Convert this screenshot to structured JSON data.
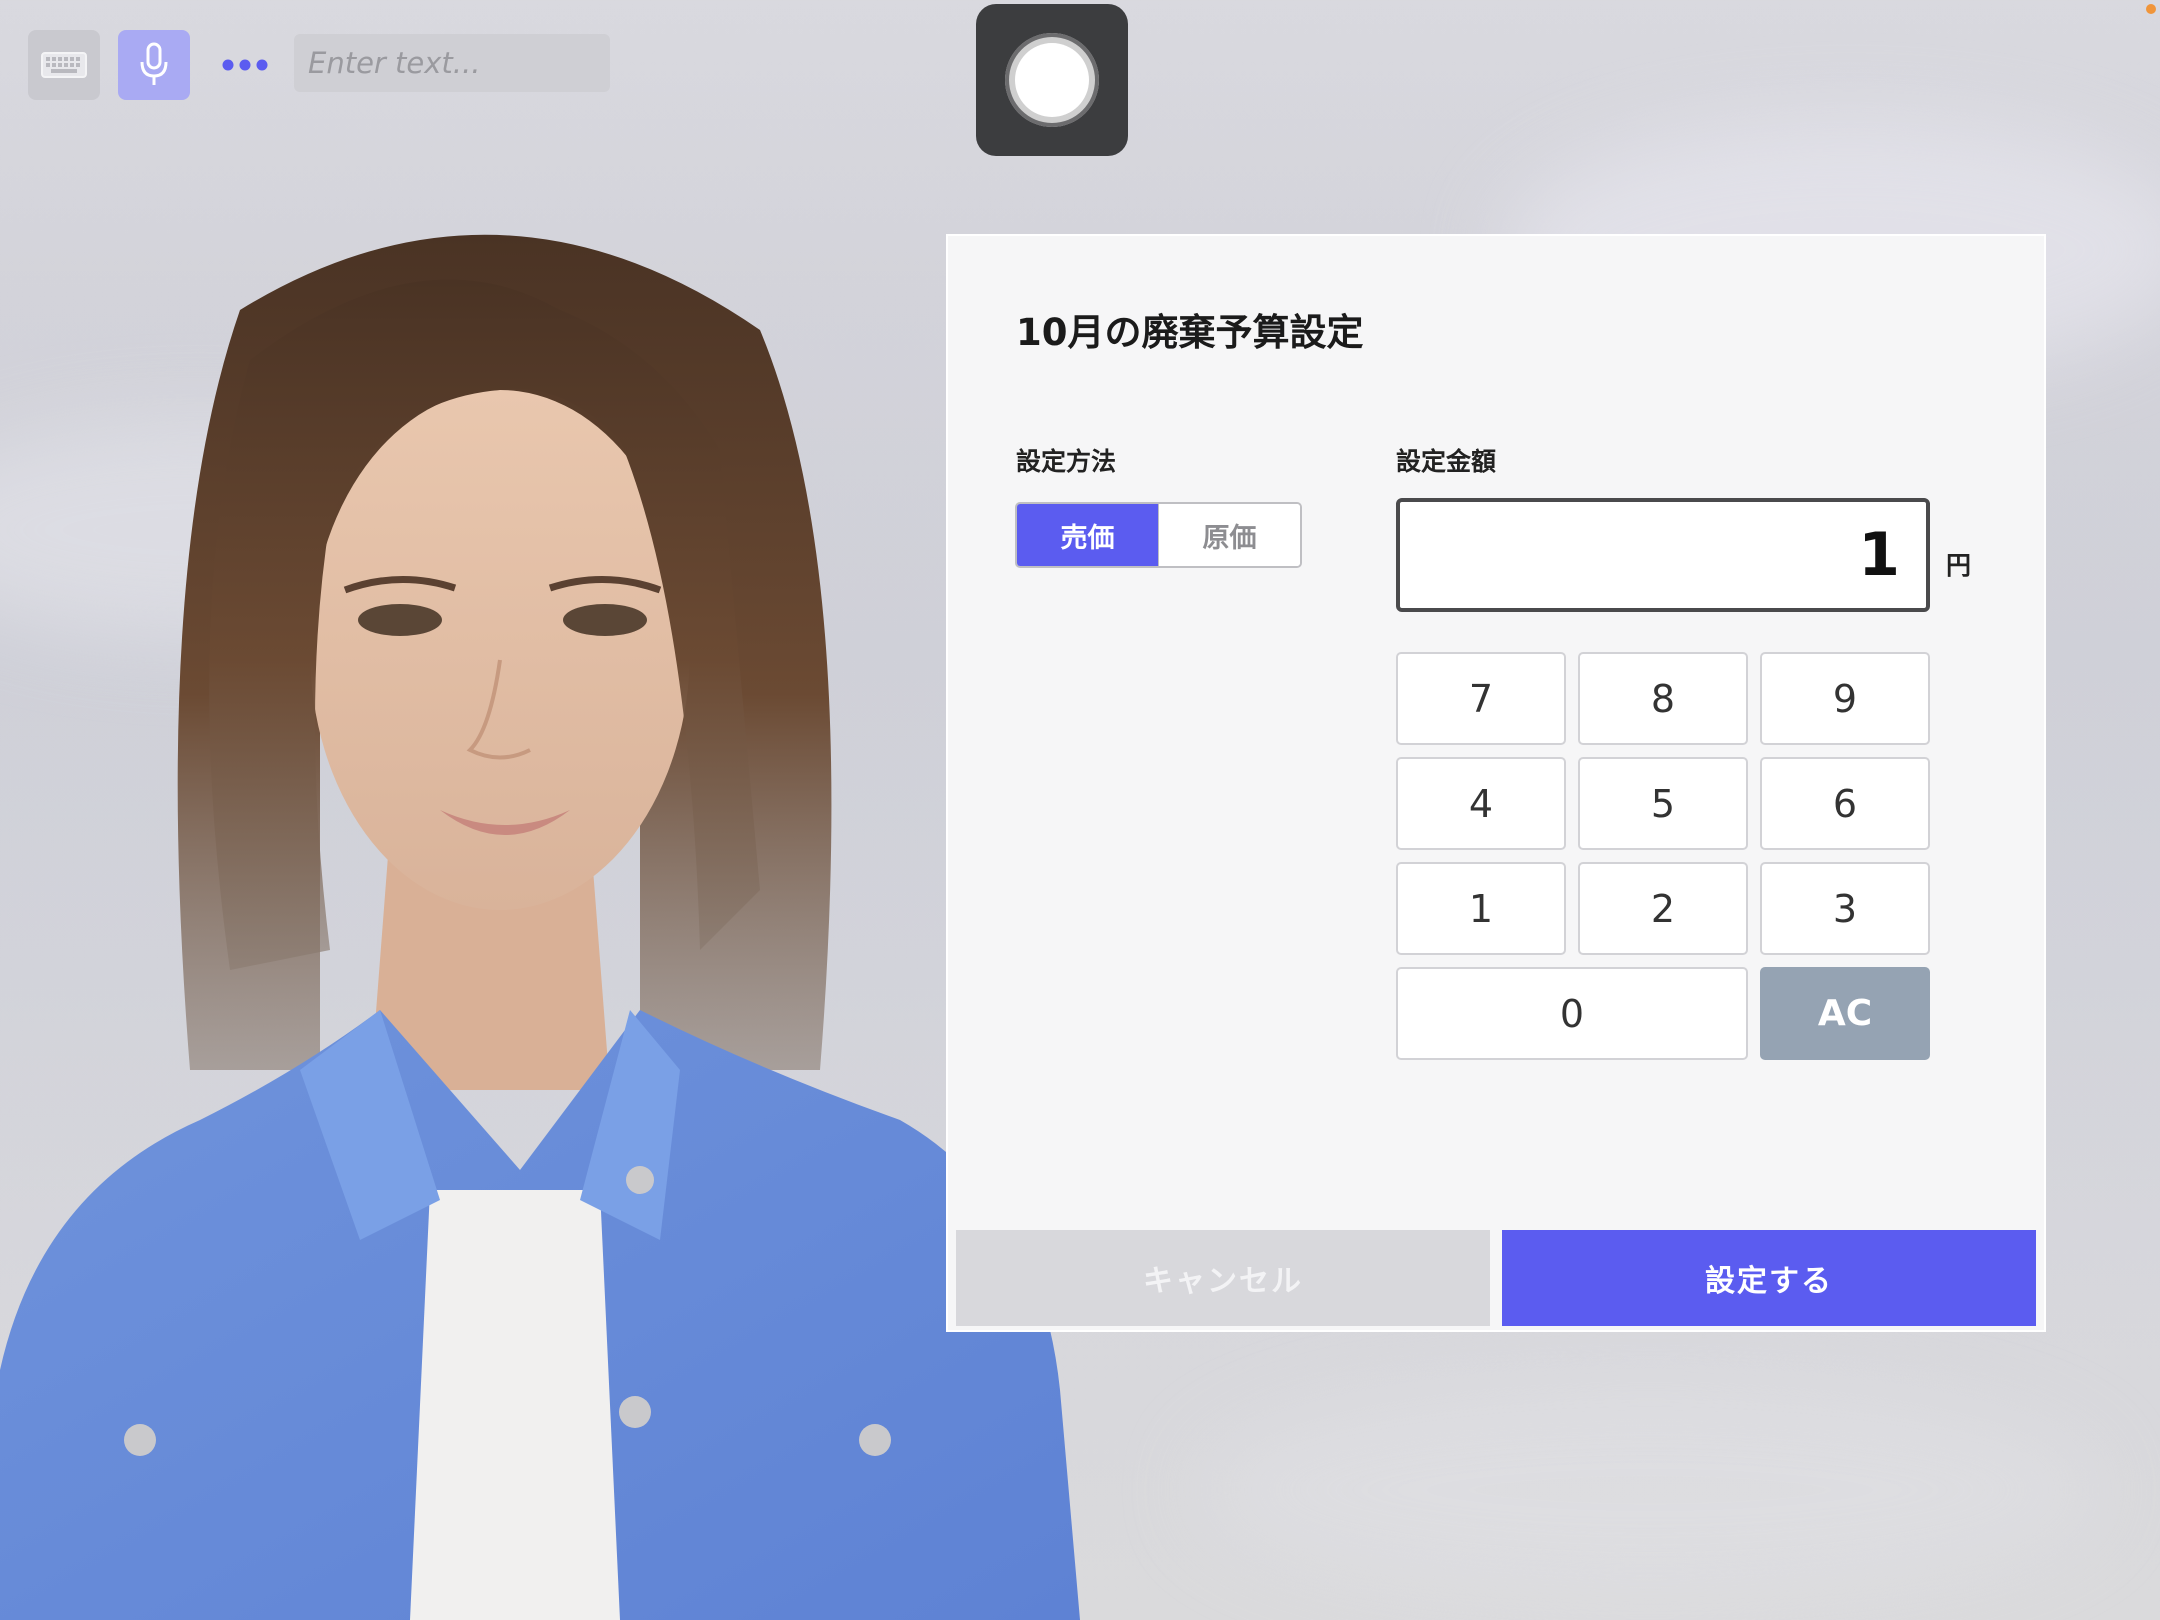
{
  "toolbar": {
    "text_placeholder": "Enter text...",
    "keyboard_icon": "keyboard-icon",
    "mic_icon": "microphone-icon",
    "more_icon": "more-dots-icon",
    "record_icon": "record-icon"
  },
  "dialog": {
    "title": "10月の廃棄予算設定",
    "method": {
      "label": "設定方法",
      "options": [
        "売価",
        "原価"
      ],
      "selected": "売価"
    },
    "amount": {
      "label": "設定金額",
      "value": "1",
      "unit": "円"
    },
    "keypad": {
      "keys": [
        "7",
        "8",
        "9",
        "4",
        "5",
        "6",
        "1",
        "2",
        "3",
        "0",
        "AC"
      ]
    },
    "cancel_label": "キャンセル",
    "submit_label": "設定する"
  },
  "colors": {
    "accent": "#5b5cf0",
    "ac_key": "#95a3b3",
    "mic_button": "#a9aaf3",
    "record_button": "#3c3d3f",
    "status_dot": "#f0953a"
  }
}
